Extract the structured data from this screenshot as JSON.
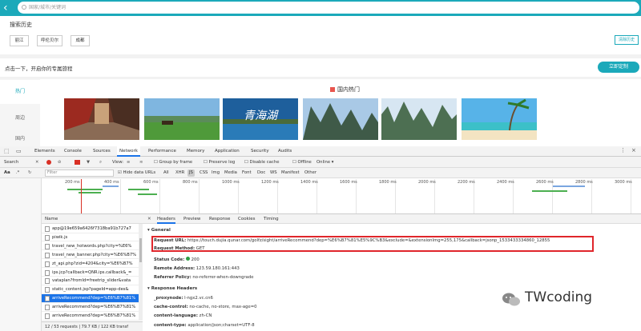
{
  "search": {
    "placeholder": "国家/城市/关键词"
  },
  "history": {
    "title": "搜索历史",
    "items": [
      "丽江",
      "呼伦贝尔",
      "成都"
    ],
    "clear": "清除历史"
  },
  "promo": {
    "text": "点击一下，开启你的专属旅程",
    "button": "立即定制"
  },
  "leftnav": [
    "热门",
    "周边",
    "国内"
  ],
  "domestic": {
    "title": "国内热门"
  },
  "photo_text": "青海湖",
  "devtools": {
    "tabs": [
      "Elements",
      "Console",
      "Sources",
      "Network",
      "Performance",
      "Memory",
      "Application",
      "Security",
      "Audits"
    ],
    "toolbar": {
      "mode": "Search",
      "view": "View:",
      "group": "Group by frame",
      "preserve": "Preserve log",
      "disable": "Disable cache",
      "offline": "Offline",
      "online": "Online"
    },
    "filterbar": {
      "aa": "Aa",
      "filter_placeholder": "Filter",
      "hide": "Hide data URLs",
      "types": [
        "All",
        "XHR",
        "JS",
        "CSS",
        "Img",
        "Media",
        "Font",
        "Doc",
        "WS",
        "Manifest",
        "Other"
      ]
    },
    "ticks": [
      "200 ms",
      "400 ms",
      "600 ms",
      "800 ms",
      "1000 ms",
      "1200 ms",
      "1400 ms",
      "1600 ms",
      "1800 ms",
      "2000 ms",
      "2200 ms",
      "2400 ms",
      "2600 ms",
      "2800 ms",
      "3000 ms"
    ],
    "list_header": "Name",
    "requests": [
      "app@19e659a6426f7318ba91b727a7",
      "piwik.js",
      "travel_new_hotwords.php?city=%E6%",
      "travel_new_banner.php?city=%E6%B7%",
      "zt_api.php?zid=4204&city=%E6%B7%",
      "ips.jcp?callback=QNR.ips.callback&_=",
      "vataplan?fromId=freetrip_slider&vata",
      "static_content.jsp?pageId=app-des&",
      "arriveRecommend?dep=%E6%B7%81%",
      "arriveRecommend?dep=%E6%B7%81%",
      "arriveRecommend?dep=%E6%B7%81%"
    ],
    "selected_index": 8,
    "status": "12 / 53 requests | 79.7 KB / 122 KB transf",
    "detail_tabs": [
      "Headers",
      "Preview",
      "Response",
      "Cookies",
      "Timing"
    ],
    "general_title": "General",
    "request_url_label": "Request URL:",
    "request_url": "https://touch.dujia.qunar.com/golfz/sight/arriveRecommend?dep=%E6%B7%81%E5%9C%B3&exclude=&extensionImg=255,175&callback=jsonp_1533433334860_12855",
    "request_method_label": "Request Method:",
    "request_method": "GET",
    "status_code_label": "Status Code:",
    "status_code": "200",
    "status_color": "#2e9e44",
    "remote_label": "Remote Address:",
    "remote": "123.59.180.161:443",
    "referrer_label": "Referrer Policy:",
    "referrer": "no-referrer-when-downgrade",
    "response_headers_title": "Response Headers",
    "response_headers": [
      {
        "k": "_proxynode:",
        "v": "l-ngx2.vc.cn6"
      },
      {
        "k": "cache-control:",
        "v": "no-cache, no-store, max-age=0"
      },
      {
        "k": "content-language:",
        "v": "zh-CN"
      },
      {
        "k": "content-type:",
        "v": "application/json;charset=UTF-8"
      }
    ]
  },
  "watermark": "TWcoding",
  "colors": {
    "accent": "#1ba9ba",
    "highlight": "#e0262b"
  }
}
